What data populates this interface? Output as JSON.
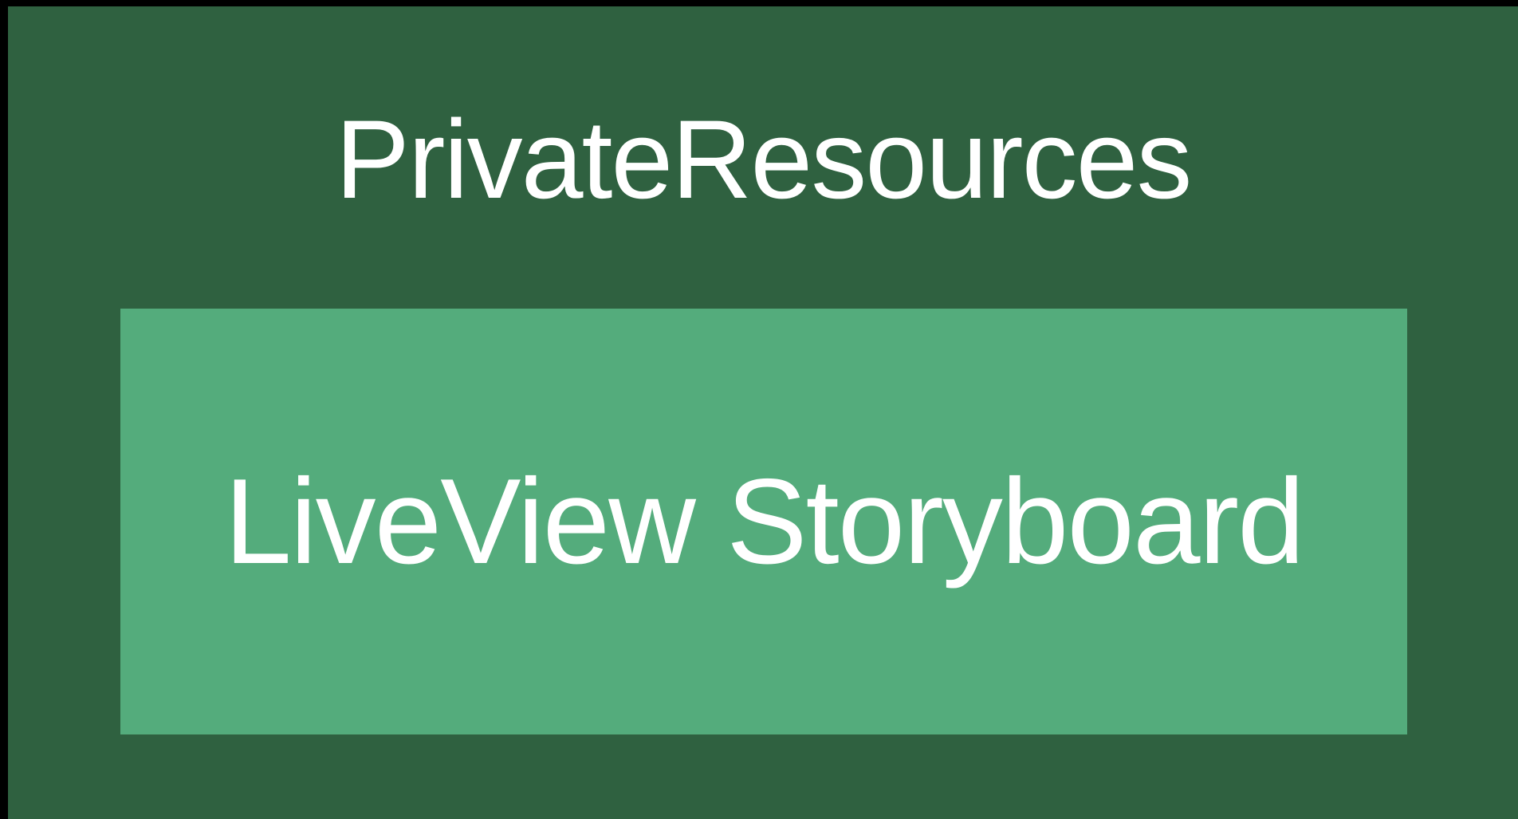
{
  "diagram": {
    "container": {
      "title": "PrivateResources",
      "color": "#2F6140"
    },
    "inner_block": {
      "label": "LiveView Storyboard",
      "color": "#54AC7C"
    },
    "background_color": "#000000",
    "text_color": "#FFFFFF"
  }
}
